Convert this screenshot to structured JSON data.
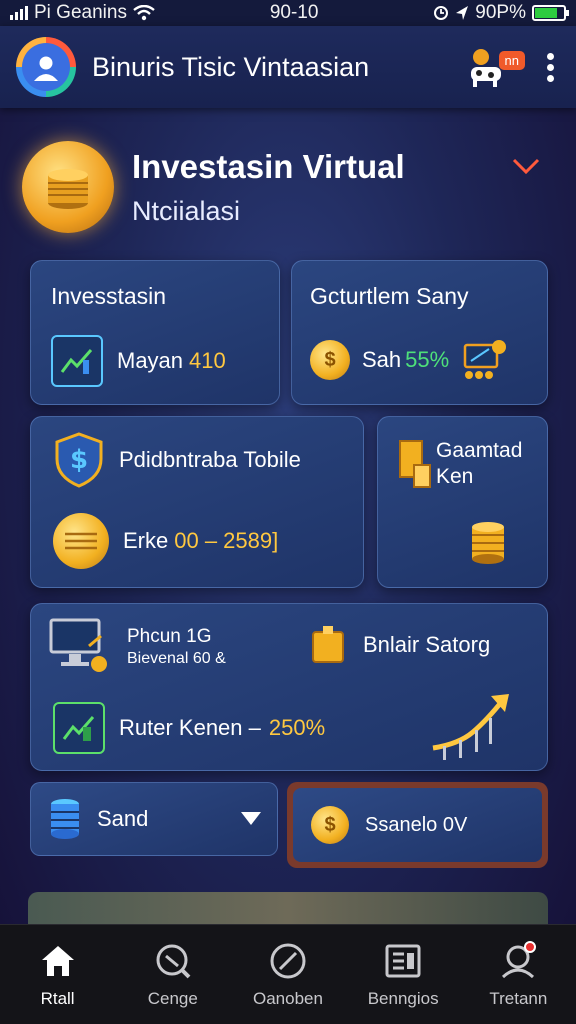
{
  "status_bar": {
    "carrier": "Pi Geanins",
    "time": "90-10",
    "battery_text": "90P%"
  },
  "header": {
    "title": "Binuris Tisic Vintaasian",
    "badge": "nn"
  },
  "hero": {
    "title": "Investasin Virtual",
    "subtitle": "Ntciialasi"
  },
  "cards": {
    "investasin": {
      "title": "Invesstasin",
      "label": "Mayan",
      "value": "410"
    },
    "current": {
      "title": "Gcturtlem Sany",
      "label": "Sah",
      "value": "55%"
    },
    "portfolio": {
      "title": "Pdidbntraba Tobile",
      "label": "Erke",
      "value": "00 – 2589]"
    },
    "guarantee": {
      "line1": "Gaamtad",
      "line2": "Ken"
    },
    "phone": {
      "title": "Phcun 1G",
      "subtitle": "Bievenal 60 &",
      "right_label": "Bnlair Satorg"
    },
    "rate": {
      "label": "Ruter Kenen –",
      "value": "250%"
    }
  },
  "actions": {
    "select_label": "Sand",
    "confirm_label": "Ssanelo 0V"
  },
  "nav": [
    {
      "label": "Rtall",
      "icon": "home-icon"
    },
    {
      "label": "Cenge",
      "icon": "search-icon"
    },
    {
      "label": "Oanoben",
      "icon": "compass-icon"
    },
    {
      "label": "Benngios",
      "icon": "document-icon"
    },
    {
      "label": "Tretann",
      "icon": "profile-icon"
    }
  ],
  "colors": {
    "accent": "#ffc840",
    "positive": "#4ee07a",
    "alert": "#f05a2a",
    "background": "#1e2657"
  }
}
